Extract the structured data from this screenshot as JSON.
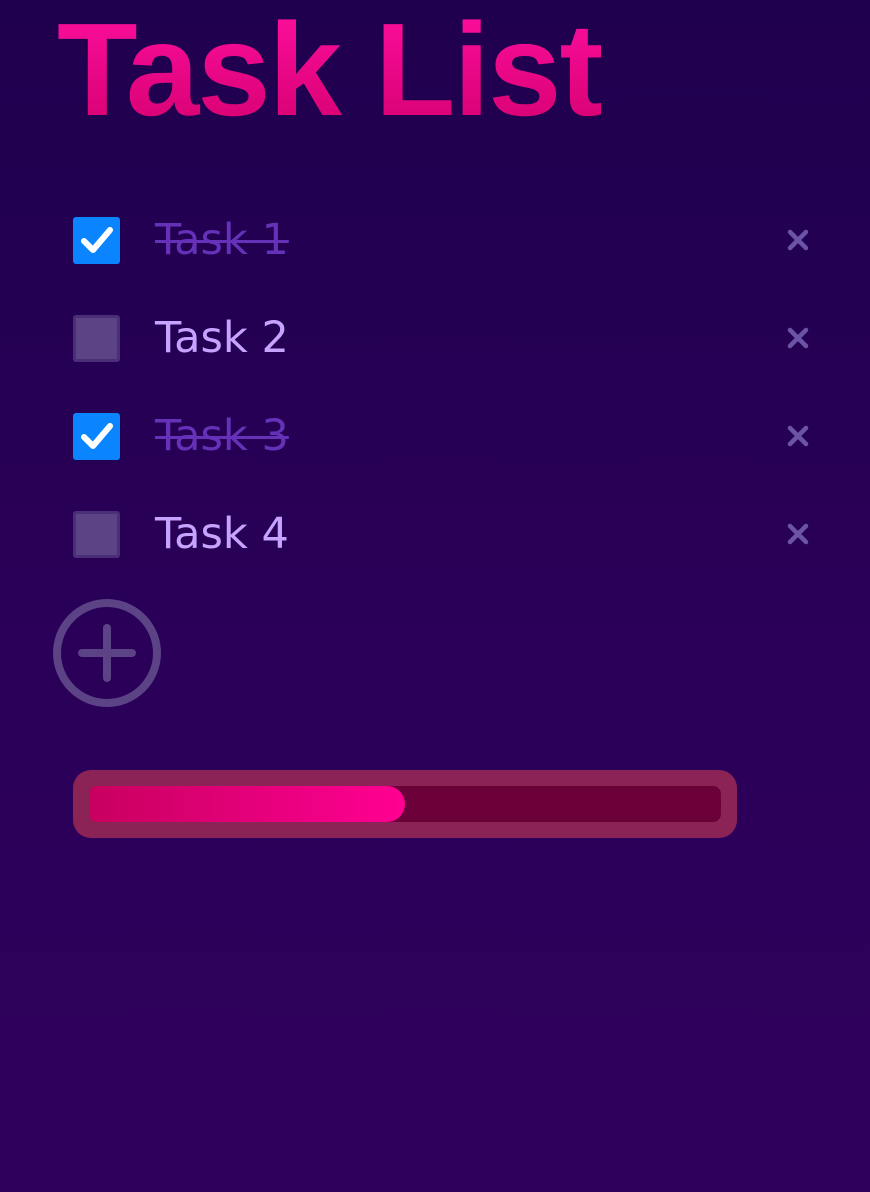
{
  "app": {
    "title": "Task List"
  },
  "colors": {
    "title_gradient_top": "#ff0fa0",
    "title_gradient_bottom": "#d4006e",
    "checkbox_checked": "#0a84ff",
    "checkbox_unchecked": "#5b4386",
    "task_done_text": "#6531b8",
    "task_open_text": "#c6a3ff",
    "delete_icon": "#6b53a6",
    "add_icon": "#5b4386",
    "progress_track": "#8c2356",
    "progress_fill": "#ff0093"
  },
  "tasks": [
    {
      "label": "Task 1",
      "done": true,
      "delete_icon": "close-icon"
    },
    {
      "label": "Task 2",
      "done": false,
      "delete_icon": "close-icon"
    },
    {
      "label": "Task 3",
      "done": true,
      "delete_icon": "close-icon"
    },
    {
      "label": "Task 4",
      "done": false,
      "delete_icon": "close-icon"
    }
  ],
  "add_button": {
    "icon": "plus-circle-icon"
  },
  "progress": {
    "completed_fraction": 0.5
  }
}
